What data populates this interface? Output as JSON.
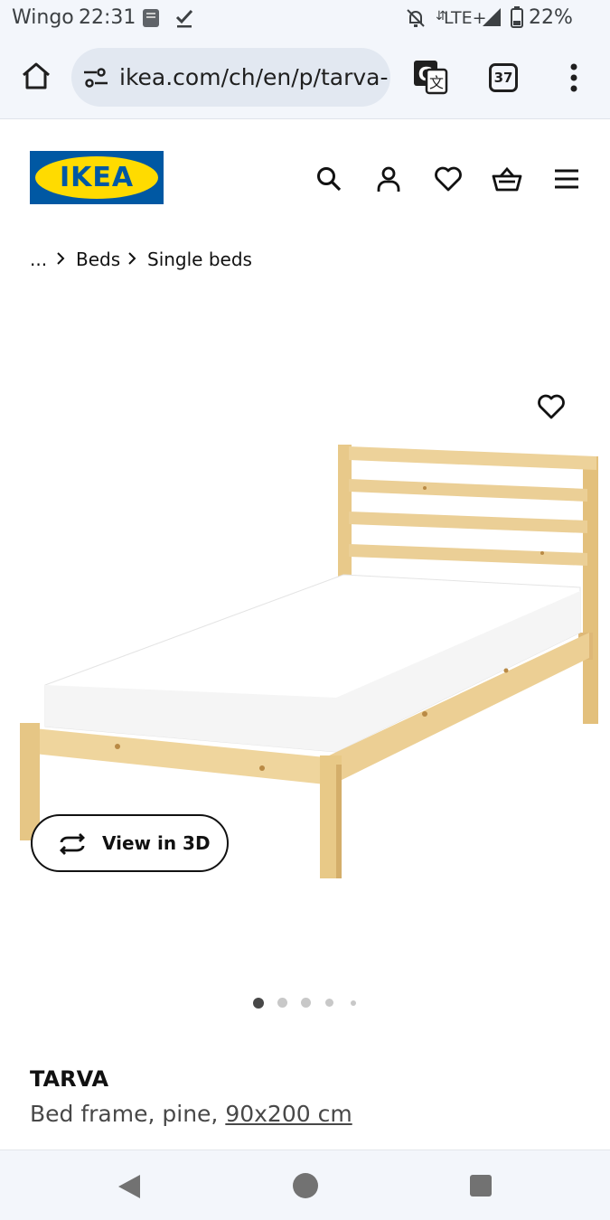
{
  "status_bar": {
    "carrier": "Wingo",
    "time": "22:31",
    "network": "LTE+",
    "battery": "22%",
    "icons": [
      "bible-app-icon",
      "check-icon",
      "bell-muted-icon",
      "signal-icon",
      "battery-icon"
    ]
  },
  "browser": {
    "url": "ikea.com/ch/en/p/tarva-",
    "tab_count": "37",
    "icons": [
      "home-icon",
      "site-info-icon",
      "translate-icon",
      "tabs-icon",
      "more-vert-icon"
    ]
  },
  "header": {
    "logo_text": "IKEA",
    "icons": [
      "search-icon",
      "profile-icon",
      "favourites-icon",
      "basket-icon",
      "menu-icon"
    ]
  },
  "breadcrumb": {
    "items": [
      "...",
      "Beds",
      "Single beds"
    ]
  },
  "gallery": {
    "view_3d_label": "View in 3D",
    "current_slide": 1,
    "dot_count": 5
  },
  "product": {
    "name": "TARVA",
    "description_prefix": "Bed frame, pine, ",
    "size": "90x200 cm"
  },
  "colors": {
    "ikea_blue": "#0058a3",
    "ikea_yellow": "#ffdb00",
    "chrome_bg": "#f3f6fb",
    "pine": "#ecd196"
  }
}
